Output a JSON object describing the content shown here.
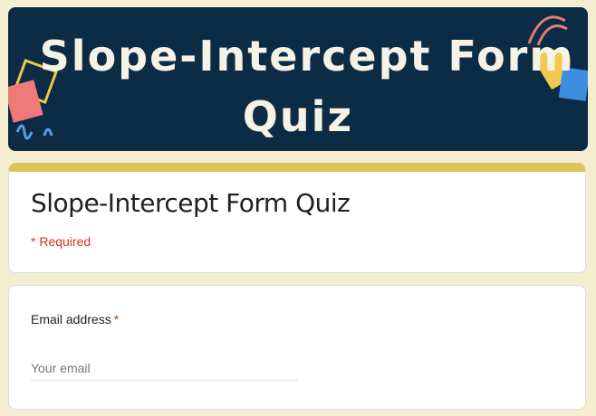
{
  "banner": {
    "line1": "Slope-Intercept Form",
    "line2": "Quiz"
  },
  "form": {
    "title": "Slope-Intercept Form Quiz",
    "required_note": "* Required"
  },
  "question": {
    "label": "Email address",
    "required_mark": "*",
    "placeholder": "Your email"
  },
  "colors": {
    "page_background": "#f4edcf",
    "banner_background": "#0c2b45",
    "accent": "#dbc55a",
    "required": "#d93025"
  }
}
